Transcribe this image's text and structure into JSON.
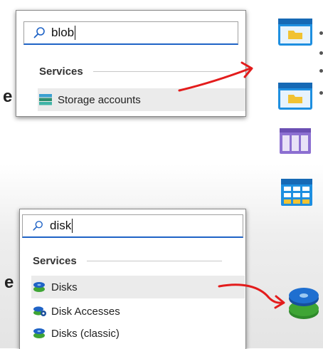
{
  "top_search": {
    "query": "blob",
    "section_title": "Services",
    "results": [
      {
        "label": "Storage accounts",
        "icon": "storage-accounts-icon"
      }
    ]
  },
  "bottom_search": {
    "query": "disk",
    "section_title": "Services",
    "results": [
      {
        "label": "Disks",
        "icon": "disks-icon"
      },
      {
        "label": "Disk Accesses",
        "icon": "disk-accesses-icon"
      },
      {
        "label": "Disks (classic)",
        "icon": "disks-classic-icon"
      }
    ]
  },
  "background_fragment": {
    "letter": "e"
  },
  "right_icons": [
    "blob-container-icon",
    "file-share-icon",
    "queue-icon",
    "table-icon",
    "managed-disk-icon"
  ],
  "colors": {
    "accent_blue": "#1f63c6",
    "annotation_red": "#e31c1c",
    "azure_blue": "#1e8fe0",
    "queue_purple": "#8c6fd1",
    "disk_green": "#3fa535"
  }
}
